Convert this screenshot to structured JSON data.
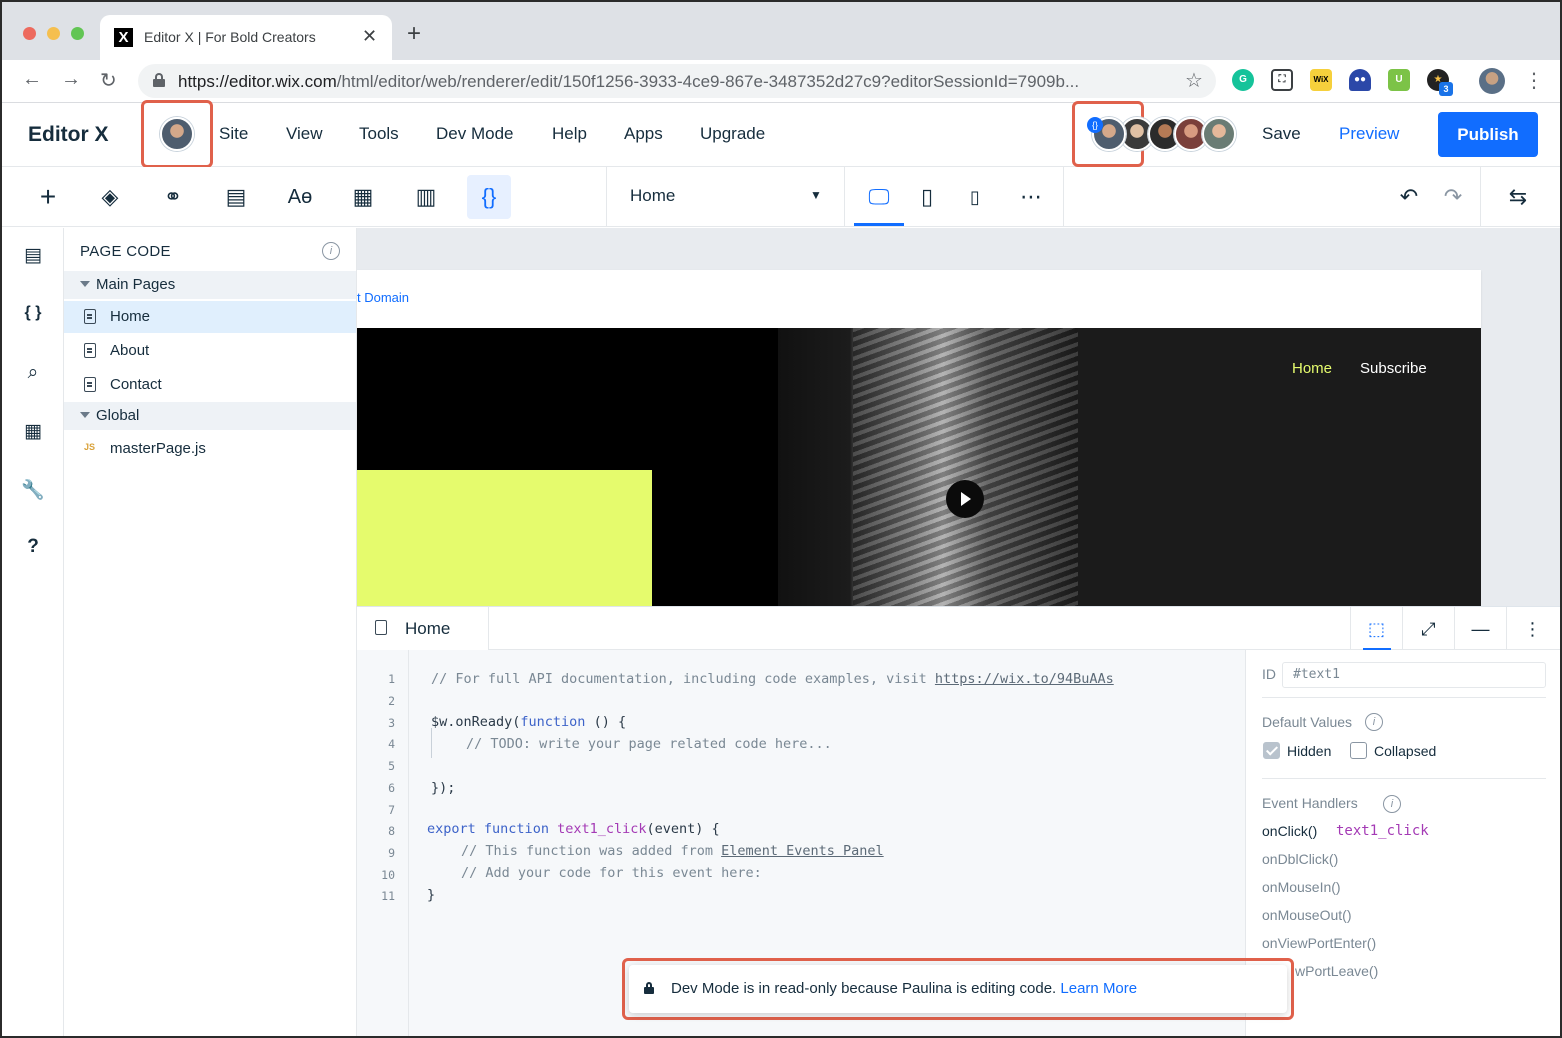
{
  "browser": {
    "tab_title": "Editor X | For Bold Creators",
    "tab_favicon": "X",
    "url_host": "https://editor.wix.com",
    "url_path": "/html/editor/web/renderer/edit/150f1256-3933-4ce9-867e-3487352d27c9?editorSessionId=7909b...",
    "extension_badge": "3",
    "icons": [
      "back-arrow-icon",
      "forward-arrow-icon",
      "reload-icon",
      "lock-icon",
      "star-icon",
      "kebab-menu-icon"
    ]
  },
  "editor": {
    "logo": "Editor X",
    "menu": [
      "Site",
      "View",
      "Tools",
      "Dev Mode",
      "Help",
      "Apps",
      "Upgrade"
    ],
    "save_label": "Save",
    "preview_label": "Preview",
    "publish_label": "Publish",
    "presence_badge": "{}",
    "accent_color": "#116dff",
    "highlight_color": "#e0614b"
  },
  "toolbar": {
    "dev_mode_icon": "{}",
    "page_selector": "Home"
  },
  "page_code": {
    "title": "PAGE CODE",
    "main_pages_label": "Main Pages",
    "pages": [
      "Home",
      "About",
      "Contact"
    ],
    "global_label": "Global",
    "global_file_badge": "JS",
    "global_files": [
      "masterPage.js"
    ]
  },
  "canvas": {
    "domain_text": "t Domain",
    "nav": [
      "Home",
      "Subscribe"
    ]
  },
  "code_editor": {
    "tab": "Home",
    "line_numbers": [
      "1",
      "2",
      "3",
      "4",
      "5",
      "6",
      "7",
      "8",
      "9",
      "10",
      "11"
    ],
    "lines": {
      "l1": "// For full API documentation, including code examples, visit ",
      "l1_link": "https://wix.to/94BuAAs",
      "l3_a": "$w.onReady(",
      "l3_kw": "function",
      "l3_b": " () {",
      "l4": "// TODO: write your page related code here...",
      "l6": "});",
      "l8_kw1": "export",
      "l8_kw2": "function",
      "l8_fn": "text1_click",
      "l8_rest": "(event) {",
      "l9": "// This function was added from ",
      "l9_link": "Element Events Panel",
      "l10": "// Add your code for this event here:",
      "l11": "}"
    }
  },
  "properties": {
    "id_label": "ID",
    "id_value": "#text1",
    "default_values_label": "Default Values",
    "hidden_label": "Hidden",
    "collapsed_label": "Collapsed",
    "event_handlers_label": "Event Handlers",
    "events": [
      "onClick()",
      "onDblClick()",
      "onMouseIn()",
      "onMouseOut()",
      "onViewPortEnter()",
      "wPortLeave()"
    ],
    "onclick_handler": "text1_click"
  },
  "toast": {
    "message": "Dev Mode is in read-only because Paulina is editing code.",
    "link": "Learn More"
  }
}
